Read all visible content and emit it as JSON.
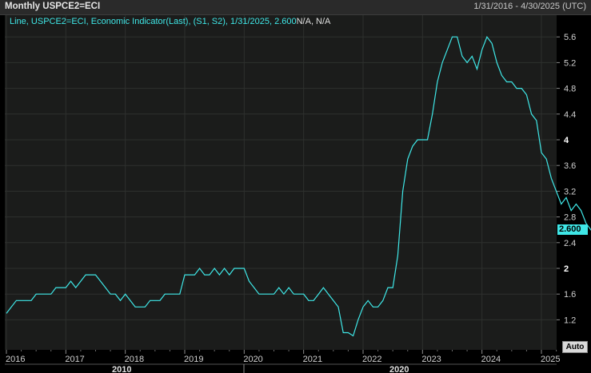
{
  "header": {
    "title": "Monthly USPCE2=ECI",
    "date_range": "1/31/2016 - 4/30/2025 (UTC)"
  },
  "legend": {
    "text": "Line, USPCE2=ECI, Economic Indicator(Last), (S1, S2), 1/31/2025, 2.600",
    "suffix": "N/A, N/A"
  },
  "last_value_label": "2.600",
  "auto_button": "Auto",
  "colors": {
    "line": "#3fe7e7",
    "plot_bg": "#1b1c1b",
    "grid": "#2e302e"
  },
  "chart_data": {
    "type": "line",
    "x_start": "2016-01",
    "x_end": "2025-01",
    "ylim": [
      0.9,
      5.8
    ],
    "y_ticks": [
      "1.2",
      "1.6",
      "2",
      "2.4",
      "2.8",
      "3.2",
      "3.6",
      "4",
      "4.4",
      "4.8",
      "5.2",
      "5.6"
    ],
    "y_bold_ticks": [
      "2",
      "4"
    ],
    "x_tick_labels": [
      "2016",
      "2017",
      "2018",
      "2019",
      "2020",
      "2021",
      "2022",
      "2023",
      "2024",
      "2025"
    ],
    "x_major_labels": [
      "2010",
      "2020"
    ],
    "series": [
      {
        "values": [
          1.3,
          1.4,
          1.5,
          1.5,
          1.5,
          1.5,
          1.6,
          1.6,
          1.6,
          1.6,
          1.7,
          1.7,
          1.7,
          1.8,
          1.7,
          1.8,
          1.9,
          1.9,
          1.9,
          1.8,
          1.7,
          1.6,
          1.6,
          1.5,
          1.6,
          1.5,
          1.4,
          1.4,
          1.4,
          1.5,
          1.5,
          1.5,
          1.6,
          1.6,
          1.6,
          1.6,
          1.9,
          1.9,
          1.9,
          2.0,
          1.9,
          1.9,
          2.0,
          1.9,
          2.0,
          1.9,
          2.0,
          2.0,
          2.0,
          1.8,
          1.7,
          1.6,
          1.6,
          1.6,
          1.6,
          1.7,
          1.6,
          1.7,
          1.6,
          1.6,
          1.6,
          1.5,
          1.5,
          1.6,
          1.7,
          1.6,
          1.5,
          1.4,
          1.0,
          1.0,
          0.95,
          1.2,
          1.4,
          1.5,
          1.4,
          1.4,
          1.5,
          1.7,
          1.7,
          2.2,
          3.2,
          3.7,
          3.9,
          4.0,
          4.0,
          4.0,
          4.4,
          4.9,
          5.2,
          5.4,
          5.6,
          5.6,
          5.3,
          5.2,
          5.3,
          5.1,
          5.4,
          5.6,
          5.5,
          5.2,
          5.0,
          4.9,
          4.9,
          4.8,
          4.8,
          4.7,
          4.4,
          4.3,
          3.8,
          3.7,
          3.4,
          3.2,
          3.0,
          3.1,
          2.9,
          3.0,
          2.9,
          2.7,
          2.6,
          2.7,
          2.7,
          2.7,
          2.8,
          2.8,
          2.9,
          2.6
        ]
      }
    ]
  }
}
